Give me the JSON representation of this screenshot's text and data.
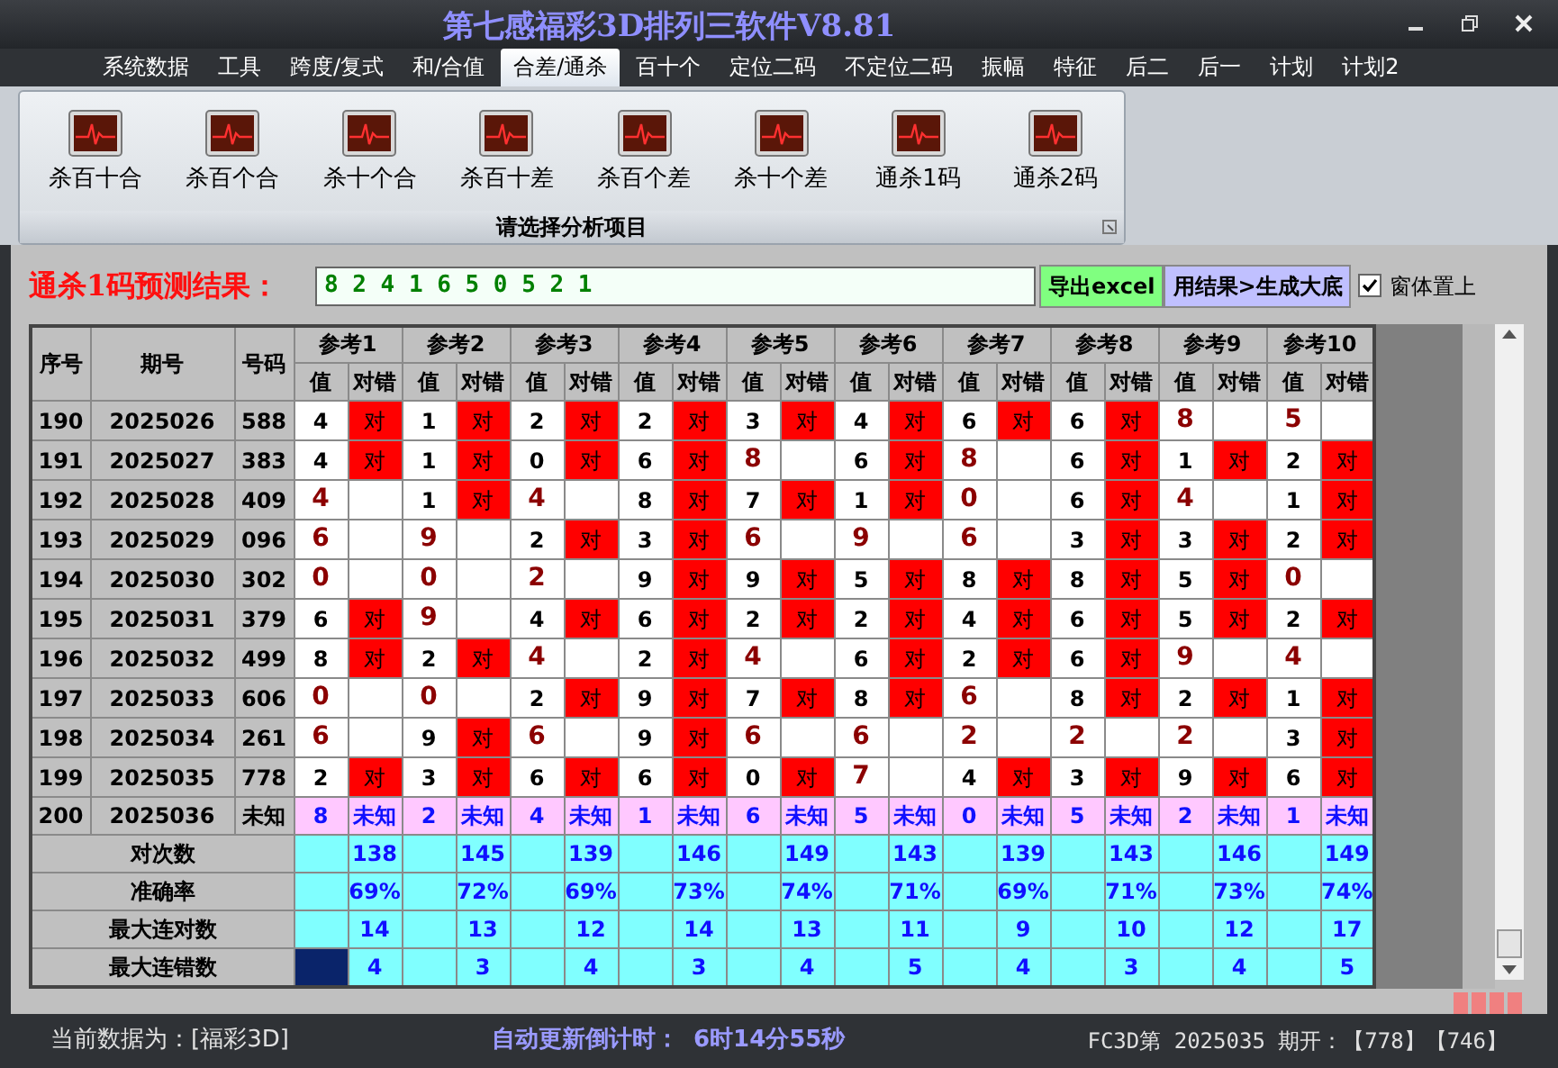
{
  "window": {
    "title": "第七感福彩3D排列三软件V8.81"
  },
  "menu": [
    {
      "label": "系统数据",
      "selected": false
    },
    {
      "label": "工具",
      "selected": false
    },
    {
      "label": "跨度/复式",
      "selected": false
    },
    {
      "label": "和/合值",
      "selected": false
    },
    {
      "label": "合差/通杀",
      "selected": true
    },
    {
      "label": "百十个",
      "selected": false
    },
    {
      "label": "定位二码",
      "selected": false
    },
    {
      "label": "不定位二码",
      "selected": false
    },
    {
      "label": "振幅",
      "selected": false
    },
    {
      "label": "特征",
      "selected": false
    },
    {
      "label": "后二",
      "selected": false
    },
    {
      "label": "后一",
      "selected": false
    },
    {
      "label": "计划",
      "selected": false
    },
    {
      "label": "计划2",
      "selected": false
    }
  ],
  "ribbon": {
    "buttons": [
      "杀百十合",
      "杀百个合",
      "杀十个合",
      "杀百十差",
      "杀百个差",
      "杀十个差",
      "通杀1码",
      "通杀2码"
    ],
    "group_label": "请选择分析项目"
  },
  "prediction": {
    "label": "通杀1码预测结果：",
    "value": "8 2 4 1 6 5 0 5 2 1"
  },
  "buttons": [
    {
      "label": "导出excel",
      "kind": "export"
    },
    {
      "label": "用结果>生成大底",
      "kind": "generate"
    }
  ],
  "stay_on_top": {
    "label": "窗体置上",
    "checked": true
  },
  "table": {
    "columns": [
      "序号",
      "期号",
      "号码"
    ],
    "refs": [
      {
        "label": "参考1",
        "sub_columns": [
          "值",
          "对错"
        ]
      },
      {
        "label": "参考2",
        "sub_columns": [
          "值",
          "对错"
        ]
      },
      {
        "label": "参考3",
        "sub_columns": [
          "值",
          "对错"
        ]
      },
      {
        "label": "参考4",
        "sub_columns": [
          "值",
          "对错"
        ]
      },
      {
        "label": "参考5",
        "sub_columns": [
          "值",
          "对错"
        ]
      },
      {
        "label": "参考6",
        "sub_columns": [
          "值",
          "对错"
        ]
      },
      {
        "label": "参考7",
        "sub_columns": [
          "值",
          "对错"
        ]
      },
      {
        "label": "参考8",
        "sub_columns": [
          "值",
          "对错"
        ]
      },
      {
        "label": "参考9",
        "sub_columns": [
          "值",
          "对错"
        ]
      },
      {
        "label": "参考10",
        "sub_columns": [
          "值",
          "对错"
        ]
      }
    ],
    "rows": [
      {
        "kind": "result",
        "seq": "190",
        "issue": "2025026",
        "number": "588",
        "cells": [
          {
            "value": "4",
            "result": "对",
            "hit": true
          },
          {
            "value": "1",
            "result": "对",
            "hit": true
          },
          {
            "value": "2",
            "result": "对",
            "hit": true
          },
          {
            "value": "2",
            "result": "对",
            "hit": true
          },
          {
            "value": "3",
            "result": "对",
            "hit": true
          },
          {
            "value": "4",
            "result": "对",
            "hit": true
          },
          {
            "value": "6",
            "result": "对",
            "hit": true
          },
          {
            "value": "6",
            "result": "对",
            "hit": true
          },
          {
            "value": "8",
            "hit": false
          },
          {
            "value": "5",
            "hit": false
          }
        ]
      },
      {
        "kind": "result",
        "seq": "191",
        "issue": "2025027",
        "number": "383",
        "cells": [
          {
            "value": "4",
            "result": "对",
            "hit": true
          },
          {
            "value": "1",
            "result": "对",
            "hit": true
          },
          {
            "value": "0",
            "result": "对",
            "hit": true
          },
          {
            "value": "6",
            "result": "对",
            "hit": true
          },
          {
            "value": "8",
            "hit": false
          },
          {
            "value": "6",
            "result": "对",
            "hit": true
          },
          {
            "value": "8",
            "hit": false
          },
          {
            "value": "6",
            "result": "对",
            "hit": true
          },
          {
            "value": "1",
            "result": "对",
            "hit": true
          },
          {
            "value": "2",
            "result": "对",
            "hit": true
          }
        ]
      },
      {
        "kind": "result",
        "seq": "192",
        "issue": "2025028",
        "number": "409",
        "cells": [
          {
            "value": "4",
            "hit": false
          },
          {
            "value": "1",
            "result": "对",
            "hit": true
          },
          {
            "value": "4",
            "hit": false
          },
          {
            "value": "8",
            "result": "对",
            "hit": true
          },
          {
            "value": "7",
            "result": "对",
            "hit": true
          },
          {
            "value": "1",
            "result": "对",
            "hit": true
          },
          {
            "value": "0",
            "hit": false
          },
          {
            "value": "6",
            "result": "对",
            "hit": true
          },
          {
            "value": "4",
            "hit": false
          },
          {
            "value": "1",
            "result": "对",
            "hit": true
          }
        ]
      },
      {
        "kind": "result",
        "seq": "193",
        "issue": "2025029",
        "number": "096",
        "cells": [
          {
            "value": "6",
            "hit": false
          },
          {
            "value": "9",
            "hit": false
          },
          {
            "value": "2",
            "result": "对",
            "hit": true
          },
          {
            "value": "3",
            "result": "对",
            "hit": true
          },
          {
            "value": "6",
            "hit": false
          },
          {
            "value": "9",
            "hit": false
          },
          {
            "value": "6",
            "hit": false
          },
          {
            "value": "3",
            "result": "对",
            "hit": true
          },
          {
            "value": "3",
            "result": "对",
            "hit": true
          },
          {
            "value": "2",
            "result": "对",
            "hit": true
          }
        ]
      },
      {
        "kind": "result",
        "seq": "194",
        "issue": "2025030",
        "number": "302",
        "cells": [
          {
            "value": "0",
            "hit": false
          },
          {
            "value": "0",
            "hit": false
          },
          {
            "value": "2",
            "hit": false
          },
          {
            "value": "9",
            "result": "对",
            "hit": true
          },
          {
            "value": "9",
            "result": "对",
            "hit": true
          },
          {
            "value": "5",
            "result": "对",
            "hit": true
          },
          {
            "value": "8",
            "result": "对",
            "hit": true
          },
          {
            "value": "8",
            "result": "对",
            "hit": true
          },
          {
            "value": "5",
            "result": "对",
            "hit": true
          },
          {
            "value": "0",
            "hit": false
          }
        ]
      },
      {
        "kind": "result",
        "seq": "195",
        "issue": "2025031",
        "number": "379",
        "cells": [
          {
            "value": "6",
            "result": "对",
            "hit": true
          },
          {
            "value": "9",
            "hit": false
          },
          {
            "value": "4",
            "result": "对",
            "hit": true
          },
          {
            "value": "6",
            "result": "对",
            "hit": true
          },
          {
            "value": "2",
            "result": "对",
            "hit": true
          },
          {
            "value": "2",
            "result": "对",
            "hit": true
          },
          {
            "value": "4",
            "result": "对",
            "hit": true
          },
          {
            "value": "6",
            "result": "对",
            "hit": true
          },
          {
            "value": "5",
            "result": "对",
            "hit": true
          },
          {
            "value": "2",
            "result": "对",
            "hit": true
          }
        ]
      },
      {
        "kind": "result",
        "seq": "196",
        "issue": "2025032",
        "number": "499",
        "cells": [
          {
            "value": "8",
            "result": "对",
            "hit": true
          },
          {
            "value": "2",
            "result": "对",
            "hit": true
          },
          {
            "value": "4",
            "hit": false
          },
          {
            "value": "2",
            "result": "对",
            "hit": true
          },
          {
            "value": "4",
            "hit": false
          },
          {
            "value": "6",
            "result": "对",
            "hit": true
          },
          {
            "value": "2",
            "result": "对",
            "hit": true
          },
          {
            "value": "6",
            "result": "对",
            "hit": true
          },
          {
            "value": "9",
            "hit": false
          },
          {
            "value": "4",
            "hit": false
          }
        ]
      },
      {
        "kind": "result",
        "seq": "197",
        "issue": "2025033",
        "number": "606",
        "cells": [
          {
            "value": "0",
            "hit": false
          },
          {
            "value": "0",
            "hit": false
          },
          {
            "value": "2",
            "result": "对",
            "hit": true
          },
          {
            "value": "9",
            "result": "对",
            "hit": true
          },
          {
            "value": "7",
            "result": "对",
            "hit": true
          },
          {
            "value": "8",
            "result": "对",
            "hit": true
          },
          {
            "value": "6",
            "hit": false
          },
          {
            "value": "8",
            "result": "对",
            "hit": true
          },
          {
            "value": "2",
            "result": "对",
            "hit": true
          },
          {
            "value": "1",
            "result": "对",
            "hit": true
          }
        ]
      },
      {
        "kind": "result",
        "seq": "198",
        "issue": "2025034",
        "number": "261",
        "cells": [
          {
            "value": "6",
            "hit": false
          },
          {
            "value": "9",
            "result": "对",
            "hit": true
          },
          {
            "value": "6",
            "hit": false
          },
          {
            "value": "9",
            "result": "对",
            "hit": true
          },
          {
            "value": "6",
            "hit": false
          },
          {
            "value": "6",
            "hit": false
          },
          {
            "value": "2",
            "hit": false
          },
          {
            "value": "2",
            "hit": false
          },
          {
            "value": "2",
            "hit": false
          },
          {
            "value": "3",
            "result": "对",
            "hit": true
          }
        ]
      },
      {
        "kind": "result",
        "seq": "199",
        "issue": "2025035",
        "number": "778",
        "cells": [
          {
            "value": "2",
            "result": "对",
            "hit": true
          },
          {
            "value": "3",
            "result": "对",
            "hit": true
          },
          {
            "value": "6",
            "result": "对",
            "hit": true
          },
          {
            "value": "6",
            "result": "对",
            "hit": true
          },
          {
            "value": "0",
            "result": "对",
            "hit": true
          },
          {
            "value": "7",
            "hit": false
          },
          {
            "value": "4",
            "result": "对",
            "hit": true
          },
          {
            "value": "3",
            "result": "对",
            "hit": true
          },
          {
            "value": "9",
            "result": "对",
            "hit": true
          },
          {
            "value": "6",
            "result": "对",
            "hit": true
          }
        ]
      },
      {
        "kind": "pending",
        "seq": "200",
        "issue": "2025036",
        "number": "未知",
        "cells": [
          {
            "value": "8",
            "result": "未知"
          },
          {
            "value": "2",
            "result": "未知"
          },
          {
            "value": "4",
            "result": "未知"
          },
          {
            "value": "1",
            "result": "未知"
          },
          {
            "value": "6",
            "result": "未知"
          },
          {
            "value": "5",
            "result": "未知"
          },
          {
            "value": "0",
            "result": "未知"
          },
          {
            "value": "5",
            "result": "未知"
          },
          {
            "value": "2",
            "result": "未知"
          },
          {
            "value": "1",
            "result": "未知"
          }
        ]
      }
    ],
    "stats": [
      {
        "label": "对次数",
        "values": [
          "138",
          "145",
          "139",
          "146",
          "149",
          "143",
          "139",
          "143",
          "146",
          "149"
        ]
      },
      {
        "label": "准确率",
        "values": [
          "69%",
          "72%",
          "69%",
          "73%",
          "74%",
          "71%",
          "69%",
          "71%",
          "73%",
          "74%"
        ]
      },
      {
        "label": "最大连对数",
        "values": [
          "14",
          "13",
          "12",
          "14",
          "13",
          "11",
          "9",
          "10",
          "12",
          "17"
        ]
      },
      {
        "label": "最大连错数",
        "values": [
          "4",
          "3",
          "4",
          "3",
          "4",
          "5",
          "4",
          "3",
          "4",
          "5"
        ],
        "first_cell_selected": true
      }
    ]
  },
  "status_bar": {
    "data_source": "当前数据为：[福彩3D]",
    "countdown_label": "自动更新倒计时：",
    "countdown": "6时14分55秒",
    "draw_info": "FC3D第 2025035 期开：【778】【746】"
  }
}
